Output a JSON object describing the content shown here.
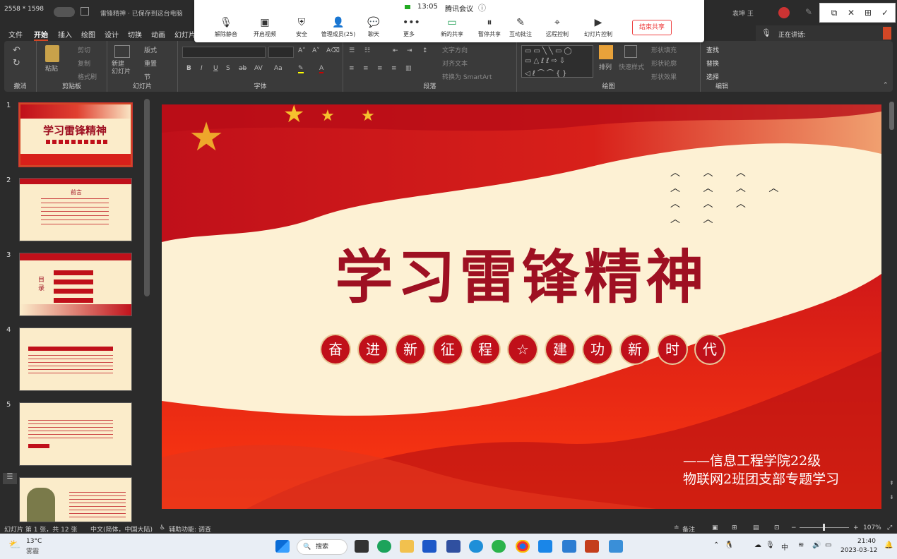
{
  "screen": {
    "resolution": "2558 * 1598"
  },
  "titlebar": {
    "file_title": "雷锋精神 · 已保存到这台电脑",
    "user_name": "袁坤 王"
  },
  "meeting": {
    "time": "13:05",
    "app_name": "腾讯会议",
    "buttons": [
      "解除静音",
      "开启视频",
      "安全",
      "管理成员(25)",
      "聊天",
      "更多",
      "新的共享",
      "暂停共享",
      "互动批注",
      "远程控制",
      "幻灯片控制"
    ],
    "end_share": "结束共享",
    "speaking_label": "正在讲话:"
  },
  "menu_tabs": [
    "文件",
    "开始",
    "插入",
    "绘图",
    "设计",
    "切换",
    "动画",
    "幻灯片"
  ],
  "ribbon": {
    "undo_group": "撤消",
    "clipboard": {
      "paste": "粘贴",
      "cut": "剪切",
      "copy": "复制",
      "format_painter": "格式刷",
      "label": "剪贴板"
    },
    "slides": {
      "new_slide": "新建\n幻灯片",
      "layout": "版式",
      "reset": "重置",
      "section": "节",
      "label": "幻灯片"
    },
    "font": {
      "label": "字体",
      "bold": "B",
      "italic": "I",
      "underline": "U",
      "strike": "S",
      "abc": "ab",
      "av": "AV",
      "aa": "Aa"
    },
    "paragraph": {
      "label": "段落",
      "text_direction": "文字方向",
      "align_text": "对齐文本",
      "smartart": "转换为 SmartArt"
    },
    "drawing": {
      "label": "绘图",
      "arrange": "排列",
      "quick_styles": "快速样式",
      "shape_fill": "形状填充",
      "shape_outline": "形状轮廓",
      "shape_effects": "形状效果"
    },
    "editing": {
      "label": "编辑",
      "find": "查找",
      "replace": "替换",
      "select": "选择"
    }
  },
  "thumbnails": [
    {
      "num": "1",
      "title": "学习雷锋精神"
    },
    {
      "num": "2",
      "title": "前言"
    },
    {
      "num": "3",
      "title": "目录"
    },
    {
      "num": "4",
      "title": ""
    },
    {
      "num": "5",
      "title": ""
    },
    {
      "num": "6",
      "title": ""
    }
  ],
  "slide": {
    "title": "学习雷锋精神",
    "slogan": [
      "奋",
      "进",
      "新",
      "征",
      "程",
      "☆",
      "建",
      "功",
      "新",
      "时",
      "代"
    ],
    "footer_line1": "——信息工程学院22级",
    "footer_line2": "物联网2班团支部专题学习"
  },
  "status": {
    "slide_count": "幻灯片 第 1 张，共 12 张",
    "language": "中文(简体，中国大陆)",
    "accessibility": "辅助功能: 调查",
    "notes": "备注",
    "zoom": "107%"
  },
  "taskbar": {
    "weather_temp": "13°C",
    "weather_desc": "雾霾",
    "search": "搜索",
    "ime": "中",
    "clock_time": "21:40",
    "clock_date": "2023-03-12"
  },
  "colors": {
    "slide_red": "#c0101a",
    "title_red": "#9e1022",
    "accent_orange": "#d24726"
  }
}
